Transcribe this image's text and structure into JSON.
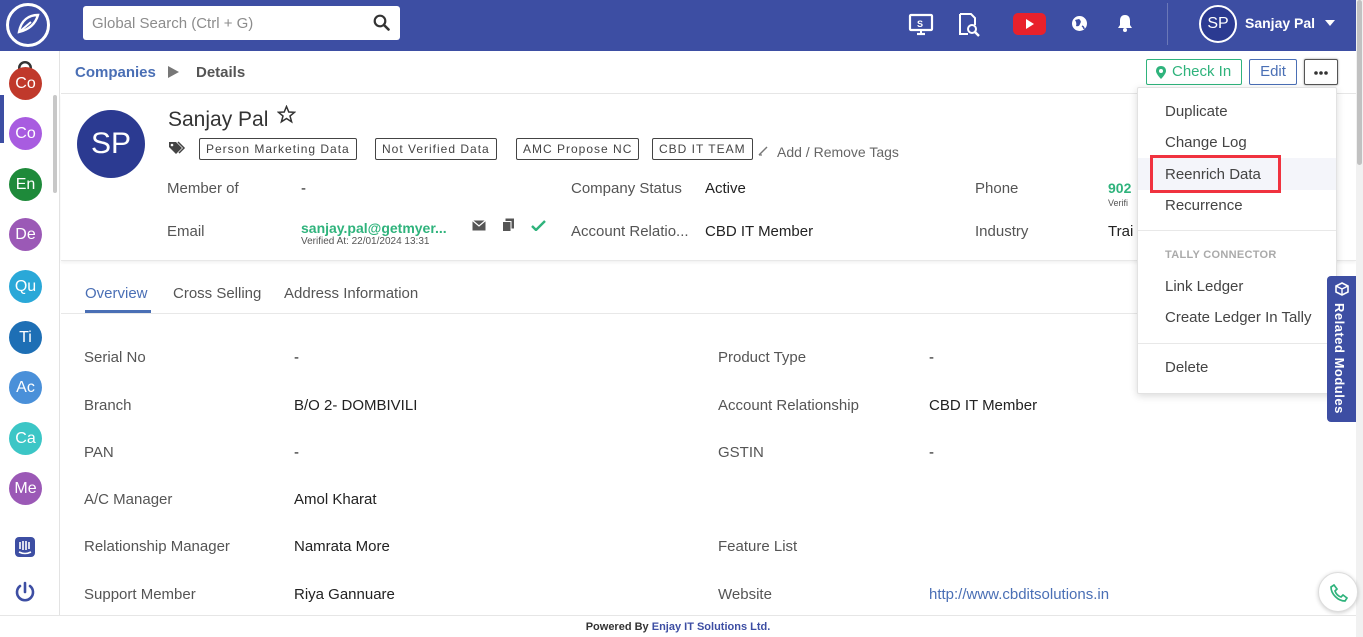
{
  "topbar": {
    "search_placeholder": "Global Search (Ctrl + G)",
    "user_initials": "SP",
    "user_name": "Sanjay Pal"
  },
  "sidebar": {
    "modules": [
      {
        "label": "Co",
        "color": "#c0392b"
      },
      {
        "label": "Co",
        "color": "#a85ce0"
      },
      {
        "label": "En",
        "color": "#1e8a3a"
      },
      {
        "label": "De",
        "color": "#9b59b6"
      },
      {
        "label": "Qu",
        "color": "#2aa8d8"
      },
      {
        "label": "Ti",
        "color": "#1e6fb5"
      },
      {
        "label": "Ac",
        "color": "#4a90d9"
      },
      {
        "label": "Ca",
        "color": "#3cc6c6"
      },
      {
        "label": "Me",
        "color": "#9b59b6"
      }
    ]
  },
  "breadcrumb": {
    "companies": "Companies",
    "details": "Details"
  },
  "actions": {
    "checkin_label": "Check In",
    "edit_label": "Edit"
  },
  "profile": {
    "initials": "SP",
    "name": "Sanjay Pal",
    "tags": [
      "Person Marketing Data",
      "Not Verified Data",
      "AMC Propose NC",
      "CBD IT TEAM"
    ],
    "add_tags_label": "Add / Remove Tags",
    "member_of_label": "Member of",
    "member_of_value": "-",
    "email_label": "Email",
    "email_value": "sanjay.pal@getmyer...",
    "email_verified": "Verified At: 22/01/2024 13:31",
    "company_status_label": "Company Status",
    "company_status_value": "Active",
    "account_rel_label": "Account Relatio...",
    "account_rel_value": "CBD IT Member",
    "phone_label": "Phone",
    "phone_value": "902",
    "phone_sub": "Verifi",
    "industry_label": "Industry",
    "industry_value": "Trai"
  },
  "tabs": [
    "Overview",
    "Cross Selling",
    "Address Information"
  ],
  "details": {
    "left": [
      {
        "label": "Serial No",
        "value": "-"
      },
      {
        "label": "Branch",
        "value": "B/O 2- DOMBIVILI"
      },
      {
        "label": "PAN",
        "value": "-"
      },
      {
        "label": "A/C Manager",
        "value": "Amol Kharat"
      },
      {
        "label": "Relationship Manager",
        "value": "Namrata More"
      },
      {
        "label": "Support Member",
        "value": "Riya Gannuare"
      }
    ],
    "right": [
      {
        "label": "Product Type",
        "value": "-"
      },
      {
        "label": "Account Relationship",
        "value": "CBD IT Member"
      },
      {
        "label": "GSTIN",
        "value": "-"
      },
      {
        "label": "Feature List",
        "value": ""
      },
      {
        "label": "Website",
        "value": "http://www.cbditsolutions.in"
      }
    ]
  },
  "dropdown": {
    "duplicate": "Duplicate",
    "change_log": "Change Log",
    "reenrich": "Reenrich Data",
    "recurrence": "Recurrence",
    "section": "TALLY CONNECTOR",
    "link_ledger": "Link Ledger",
    "create_ledger": "Create Ledger In Tally",
    "delete": "Delete"
  },
  "related_modules": "Related Modules",
  "footer": {
    "prefix": "Powered By",
    "brand": "Enjay IT Solutions Ltd."
  }
}
